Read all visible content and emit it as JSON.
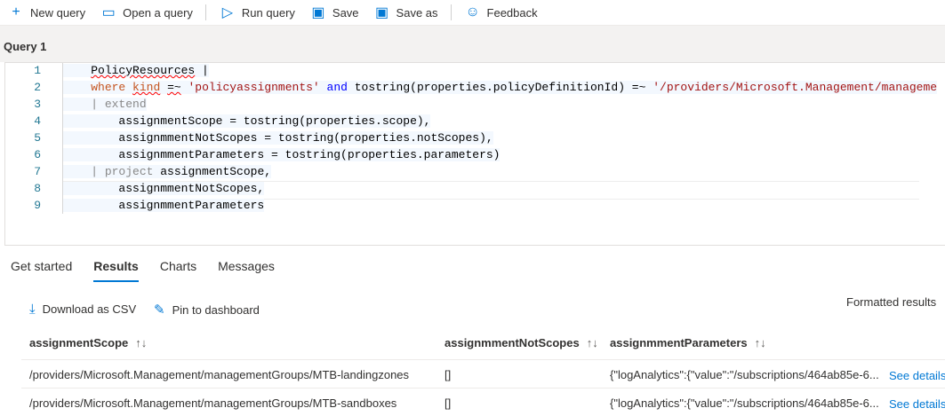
{
  "toolbar": {
    "new_query": "New query",
    "open_query": "Open a query",
    "run_query": "Run query",
    "save": "Save",
    "save_as": "Save as",
    "feedback": "Feedback",
    "icons": {
      "new": "plus-icon",
      "open": "folder-icon",
      "run": "play-icon",
      "save": "save-icon",
      "feedback": "feedback-icon"
    }
  },
  "query_tab": "Query 1",
  "editor": {
    "line_numbers": [
      "1",
      "2",
      "3",
      "4",
      "5",
      "6",
      "7",
      "8",
      "9"
    ],
    "lines": [
      [
        {
          "t": "    "
        },
        {
          "t": "PolicyResources",
          "c": "sq"
        },
        {
          "t": " |"
        }
      ],
      [
        {
          "t": "    "
        },
        {
          "t": "where",
          "c": "kw"
        },
        {
          "t": " "
        },
        {
          "t": "kind",
          "c": "kw sq"
        },
        {
          "t": " "
        },
        {
          "t": "=~",
          "c": "sq"
        },
        {
          "t": " "
        },
        {
          "t": "'policyassignments'",
          "c": "st"
        },
        {
          "t": " "
        },
        {
          "t": "and",
          "c": "kb"
        },
        {
          "t": " tostring(properties.policyDefinitionId) =~ "
        },
        {
          "t": "'/providers/Microsoft.Management/manageme",
          "c": "st"
        }
      ],
      [
        {
          "t": "    "
        },
        {
          "t": "| extend",
          "c": "gr"
        }
      ],
      [
        {
          "t": "        assignmentScope = tostring(properties.scope),"
        }
      ],
      [
        {
          "t": "        assignmmentNotScopes = tostring(properties.notScopes),"
        }
      ],
      [
        {
          "t": "        assignmmentParameters = tostring(properties.parameters)"
        }
      ],
      [
        {
          "t": "    "
        },
        {
          "t": "| project",
          "c": "gr"
        },
        {
          "t": " assignmentScope,"
        }
      ],
      [
        {
          "t": "        assignmmentNotScopes,"
        }
      ],
      [
        {
          "t": "        assignmmentParameters"
        }
      ]
    ]
  },
  "results": {
    "tabs": [
      {
        "label": "Get started"
      },
      {
        "label": "Results",
        "active": true
      },
      {
        "label": "Charts"
      },
      {
        "label": "Messages"
      }
    ],
    "download_csv": "Download as CSV",
    "pin_dashboard": "Pin to dashboard",
    "formatted_results": "Formatted results",
    "columns": [
      "assignmentScope",
      "assignmmentNotScopes",
      "assignmmentParameters"
    ],
    "sort_glyph": "↑↓",
    "rows": [
      {
        "scope": "/providers/Microsoft.Management/managementGroups/MTB-landingzones",
        "notScopes": "[]",
        "parameters": "{\"logAnalytics\":{\"value\":\"/subscriptions/464ab85e-6...",
        "details": "See details"
      },
      {
        "scope": "/providers/Microsoft.Management/managementGroups/MTB-sandboxes",
        "notScopes": "[]",
        "parameters": "{\"logAnalytics\":{\"value\":\"/subscriptions/464ab85e-6...",
        "details": "See details"
      }
    ]
  },
  "colors": {
    "accent": "#0078d4"
  }
}
